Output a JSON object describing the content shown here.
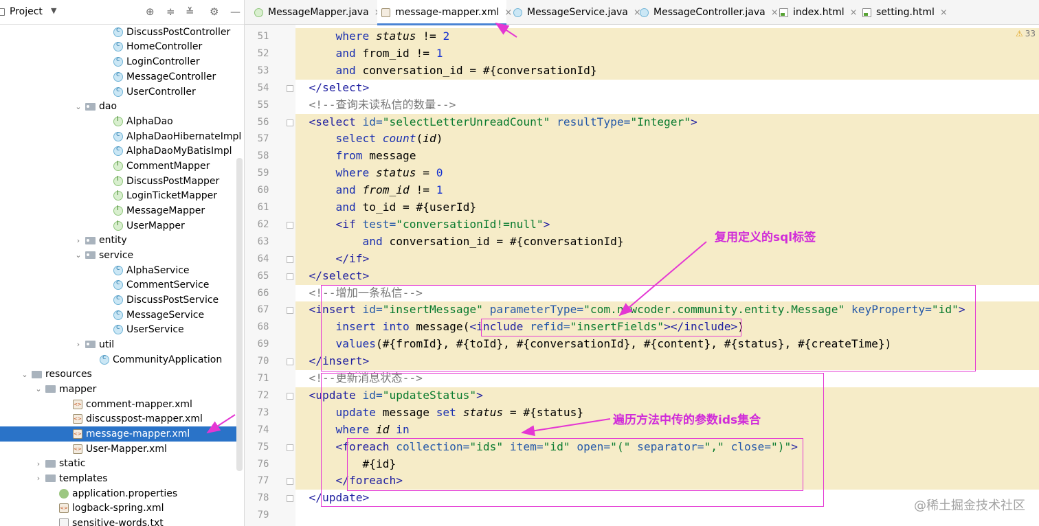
{
  "project_panel": {
    "title": "Project",
    "tree": [
      {
        "label": "DiscussPostController",
        "icon": "class-icon",
        "indent": 165
      },
      {
        "label": "HomeController",
        "icon": "class-icon",
        "indent": 165
      },
      {
        "label": "LoginController",
        "icon": "class-icon",
        "indent": 165
      },
      {
        "label": "MessageController",
        "icon": "class-icon",
        "indent": 165
      },
      {
        "label": "UserController",
        "icon": "class-icon",
        "indent": 165
      },
      {
        "label": "dao",
        "icon": "package-icon",
        "indent": 124,
        "arrow": "v"
      },
      {
        "label": "AlphaDao",
        "icon": "interface-icon",
        "indent": 165
      },
      {
        "label": "AlphaDaoHibernateImpl",
        "icon": "class-icon",
        "indent": 165
      },
      {
        "label": "AlphaDaoMyBatisImpl",
        "icon": "class-icon",
        "indent": 165
      },
      {
        "label": "CommentMapper",
        "icon": "interface-icon",
        "indent": 165
      },
      {
        "label": "DiscussPostMapper",
        "icon": "interface-icon",
        "indent": 165
      },
      {
        "label": "LoginTicketMapper",
        "icon": "interface-icon",
        "indent": 165
      },
      {
        "label": "MessageMapper",
        "icon": "interface-icon",
        "indent": 165
      },
      {
        "label": "UserMapper",
        "icon": "interface-icon",
        "indent": 165
      },
      {
        "label": "entity",
        "icon": "package-icon",
        "indent": 124,
        "arrow": ">"
      },
      {
        "label": "service",
        "icon": "package-icon",
        "indent": 124,
        "arrow": "v"
      },
      {
        "label": "AlphaService",
        "icon": "class-icon",
        "indent": 165
      },
      {
        "label": "CommentService",
        "icon": "class-icon",
        "indent": 165
      },
      {
        "label": "DiscussPostService",
        "icon": "class-icon",
        "indent": 165
      },
      {
        "label": "MessageService",
        "icon": "class-icon",
        "indent": 165
      },
      {
        "label": "UserService",
        "icon": "class-icon",
        "indent": 165
      },
      {
        "label": "util",
        "icon": "package-icon",
        "indent": 124,
        "arrow": ">"
      },
      {
        "label": "CommunityApplication",
        "icon": "class-icon",
        "indent": 145
      },
      {
        "label": "resources",
        "icon": "folder-icon",
        "indent": 46,
        "arrow": "v"
      },
      {
        "label": "mapper",
        "icon": "folder-icon",
        "indent": 66,
        "arrow": "v"
      },
      {
        "label": "comment-mapper.xml",
        "icon": "xml-icon",
        "indent": 106
      },
      {
        "label": "discusspost-mapper.xml",
        "icon": "xml-icon",
        "indent": 106
      },
      {
        "label": "message-mapper.xml",
        "icon": "xml-icon",
        "indent": 106,
        "selected": true
      },
      {
        "label": "User-Mapper.xml",
        "icon": "xml-icon",
        "indent": 106
      },
      {
        "label": "static",
        "icon": "folder-icon",
        "indent": 66,
        "arrow": ">"
      },
      {
        "label": "templates",
        "icon": "folder-icon",
        "indent": 66,
        "arrow": ">"
      },
      {
        "label": "application.properties",
        "icon": "leaf-icon",
        "indent": 86
      },
      {
        "label": "logback-spring.xml",
        "icon": "xml-icon",
        "indent": 86
      },
      {
        "label": "sensitive-words.txt",
        "icon": "text-file-icon",
        "indent": 86
      }
    ]
  },
  "tabs": [
    {
      "label": "MessageMapper.java",
      "icon": "interface-icon"
    },
    {
      "label": "message-mapper.xml",
      "icon": "xml-icon",
      "active": true
    },
    {
      "label": "MessageService.java",
      "icon": "class-icon"
    },
    {
      "label": "MessageController.java",
      "icon": "class-icon"
    },
    {
      "label": "index.html",
      "icon": "html-icon"
    },
    {
      "label": "setting.html",
      "icon": "html-icon"
    }
  ],
  "tab_close_glyph": "×",
  "warning_count": "33",
  "code_lines": [
    {
      "n": "51",
      "band": true,
      "t": [
        [
          "      ",
          ""
        ],
        [
          "where",
          "kw"
        ],
        [
          " ",
          ""
        ],
        [
          "status",
          "it"
        ],
        [
          " != ",
          ""
        ],
        [
          "2",
          "nu"
        ]
      ]
    },
    {
      "n": "52",
      "band": true,
      "t": [
        [
          "      ",
          ""
        ],
        [
          "and",
          "kw"
        ],
        [
          " from_id != ",
          ""
        ],
        [
          "1",
          "nu"
        ]
      ]
    },
    {
      "n": "53",
      "band": true,
      "t": [
        [
          "      ",
          ""
        ],
        [
          "and",
          "kw"
        ],
        [
          " conversation_id = #{conversationId}",
          ""
        ]
      ]
    },
    {
      "n": "54",
      "band": false,
      "t": [
        [
          "  ",
          ""
        ],
        [
          "</select>",
          "tg"
        ]
      ]
    },
    {
      "n": "55",
      "band": false,
      "t": [
        [
          "  <!--查询未读私信的数量-->",
          "cm"
        ]
      ]
    },
    {
      "n": "56",
      "band": true,
      "t": [
        [
          "  ",
          ""
        ],
        [
          "<select ",
          "tg"
        ],
        [
          "id=",
          "at"
        ],
        [
          "\"selectLetterUnreadCount\"",
          "av"
        ],
        [
          " ",
          ""
        ],
        [
          "resultType=",
          "at"
        ],
        [
          "\"Integer\"",
          "av"
        ],
        [
          ">",
          "tg"
        ]
      ]
    },
    {
      "n": "57",
      "band": true,
      "t": [
        [
          "      ",
          ""
        ],
        [
          "select",
          "kw"
        ],
        [
          " ",
          ""
        ],
        [
          "count",
          "kw it"
        ],
        [
          "(",
          ""
        ],
        [
          "id",
          "it"
        ],
        [
          ")",
          ""
        ]
      ]
    },
    {
      "n": "58",
      "band": true,
      "t": [
        [
          "      ",
          ""
        ],
        [
          "from",
          "kw"
        ],
        [
          " message",
          ""
        ]
      ]
    },
    {
      "n": "59",
      "band": true,
      "t": [
        [
          "      ",
          ""
        ],
        [
          "where",
          "kw"
        ],
        [
          " ",
          ""
        ],
        [
          "status",
          "it"
        ],
        [
          " = ",
          ""
        ],
        [
          "0",
          "nu"
        ]
      ]
    },
    {
      "n": "60",
      "band": true,
      "t": [
        [
          "      ",
          ""
        ],
        [
          "and",
          "kw"
        ],
        [
          " ",
          ""
        ],
        [
          "from_id",
          "it"
        ],
        [
          " != ",
          ""
        ],
        [
          "1",
          "nu"
        ]
      ]
    },
    {
      "n": "61",
      "band": true,
      "t": [
        [
          "      ",
          ""
        ],
        [
          "and",
          "kw"
        ],
        [
          " to_id = #{userId}",
          ""
        ]
      ]
    },
    {
      "n": "62",
      "band": true,
      "t": [
        [
          "      ",
          ""
        ],
        [
          "<if ",
          "tg"
        ],
        [
          "test=",
          "at"
        ],
        [
          "\"conversationId!=null\"",
          "av"
        ],
        [
          ">",
          "tg"
        ]
      ]
    },
    {
      "n": "63",
      "band": true,
      "t": [
        [
          "          ",
          ""
        ],
        [
          "and",
          "kw"
        ],
        [
          " conversation_id = #{conversationId}",
          ""
        ]
      ]
    },
    {
      "n": "64",
      "band": true,
      "t": [
        [
          "      ",
          ""
        ],
        [
          "</if>",
          "tg"
        ]
      ]
    },
    {
      "n": "65",
      "band": true,
      "t": [
        [
          "  ",
          ""
        ],
        [
          "</select>",
          "tg"
        ]
      ]
    },
    {
      "n": "66",
      "band": false,
      "t": [
        [
          "  <!--增加一条私信-->",
          "cm"
        ]
      ]
    },
    {
      "n": "67",
      "band": true,
      "t": [
        [
          "  ",
          ""
        ],
        [
          "<insert ",
          "tg"
        ],
        [
          "id=",
          "at"
        ],
        [
          "\"insertMessage\"",
          "av"
        ],
        [
          " ",
          ""
        ],
        [
          "parameterType=",
          "at"
        ],
        [
          "\"com.nowcoder.community.entity.Message\"",
          "av"
        ],
        [
          " ",
          ""
        ],
        [
          "keyProperty=",
          "at"
        ],
        [
          "\"id\"",
          "av"
        ],
        [
          ">",
          "tg"
        ]
      ]
    },
    {
      "n": "68",
      "band": true,
      "t": [
        [
          "      ",
          ""
        ],
        [
          "insert into",
          "kw"
        ],
        [
          " message(",
          ""
        ],
        [
          "<include ",
          "tg"
        ],
        [
          "refid=",
          "at"
        ],
        [
          "\"insertFields\"",
          "av"
        ],
        [
          "></include>",
          "tg"
        ],
        [
          ")",
          ""
        ]
      ]
    },
    {
      "n": "69",
      "band": true,
      "t": [
        [
          "      ",
          ""
        ],
        [
          "values",
          "kw"
        ],
        [
          "(#{fromId}, #{toId}, #{conversationId}, #{content}, #{status}, #{createTime})",
          ""
        ]
      ]
    },
    {
      "n": "70",
      "band": true,
      "t": [
        [
          "  ",
          ""
        ],
        [
          "</insert>",
          "tg"
        ]
      ]
    },
    {
      "n": "71",
      "band": false,
      "t": [
        [
          "  <!--更新消息状态-->",
          "cm"
        ]
      ]
    },
    {
      "n": "72",
      "band": true,
      "t": [
        [
          "  ",
          ""
        ],
        [
          "<update ",
          "tg"
        ],
        [
          "id=",
          "at"
        ],
        [
          "\"updateStatus\"",
          "av"
        ],
        [
          ">",
          "tg"
        ]
      ]
    },
    {
      "n": "73",
      "band": true,
      "t": [
        [
          "      ",
          ""
        ],
        [
          "update",
          "kw"
        ],
        [
          " message ",
          ""
        ],
        [
          "set",
          "kw"
        ],
        [
          " ",
          ""
        ],
        [
          "status",
          "it"
        ],
        [
          " = #{status}",
          ""
        ]
      ]
    },
    {
      "n": "74",
      "band": true,
      "t": [
        [
          "      ",
          ""
        ],
        [
          "where",
          "kw"
        ],
        [
          " ",
          ""
        ],
        [
          "id",
          "it"
        ],
        [
          " ",
          ""
        ],
        [
          "in",
          "kw"
        ]
      ]
    },
    {
      "n": "75",
      "band": true,
      "t": [
        [
          "      ",
          ""
        ],
        [
          "<foreach ",
          "tg"
        ],
        [
          "collection=",
          "at"
        ],
        [
          "\"ids\"",
          "av"
        ],
        [
          " ",
          ""
        ],
        [
          "item=",
          "at"
        ],
        [
          "\"id\"",
          "av"
        ],
        [
          " ",
          ""
        ],
        [
          "open=",
          "at"
        ],
        [
          "\"(\"",
          "av"
        ],
        [
          " ",
          ""
        ],
        [
          "separator=",
          "at"
        ],
        [
          "\",\"",
          "av"
        ],
        [
          " ",
          ""
        ],
        [
          "close=",
          "at"
        ],
        [
          "\")\"",
          "av"
        ],
        [
          ">",
          "tg"
        ]
      ]
    },
    {
      "n": "76",
      "band": true,
      "t": [
        [
          "          #{id}",
          ""
        ]
      ]
    },
    {
      "n": "77",
      "band": true,
      "hl": true,
      "t": [
        [
          "      ",
          ""
        ],
        [
          "</foreach>",
          "tg"
        ]
      ]
    },
    {
      "n": "78",
      "band": false,
      "t": [
        [
          "  ",
          ""
        ],
        [
          "</update>",
          "tg"
        ]
      ]
    },
    {
      "n": "79",
      "band": false,
      "t": [
        [
          "",
          ""
        ]
      ]
    }
  ],
  "annotations": {
    "reuse_sql": "复用定义的sql标签",
    "foreach_ids": "遍历方法中传的参数ids集合"
  },
  "watermark": "@稀土掘金技术社区",
  "colors": {
    "accent": "#2a73c8",
    "annotation": "#e437d3",
    "band": "#f6ecc8"
  }
}
